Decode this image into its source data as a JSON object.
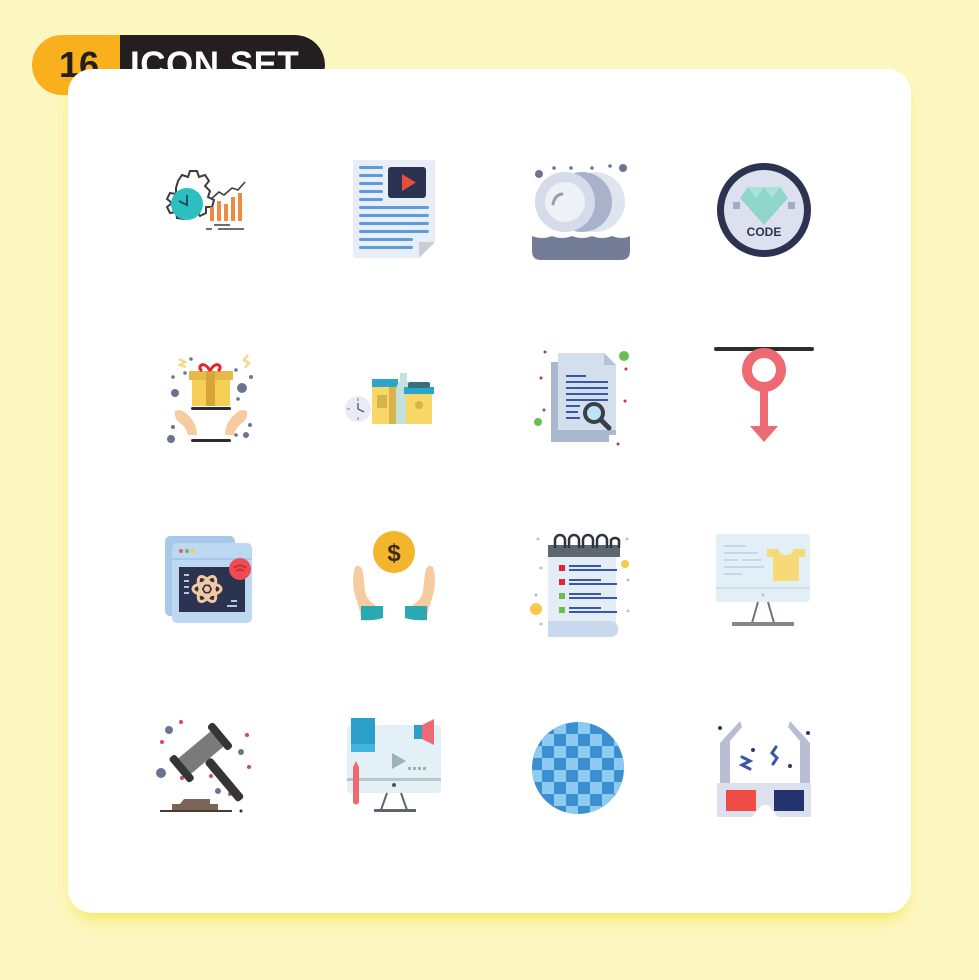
{
  "header": {
    "count": "16",
    "title": "ICON SET"
  },
  "colors": {
    "background": "#fcf7c1",
    "badge_accent": "#f8b01c",
    "badge_dark": "#231f20",
    "card": "#ffffff"
  },
  "icons": [
    {
      "name": "productivity-growth-icon",
      "text": ""
    },
    {
      "name": "video-document-icon",
      "text": ""
    },
    {
      "name": "dishes-washing-icon",
      "text": ""
    },
    {
      "name": "diamond-code-badge-icon",
      "text": "CODE"
    },
    {
      "name": "gift-in-hands-icon",
      "text": ""
    },
    {
      "name": "breakfast-food-icon",
      "text": ""
    },
    {
      "name": "document-search-icon",
      "text": ""
    },
    {
      "name": "male-symbol-arrow-down-icon",
      "text": ""
    },
    {
      "name": "science-browser-icon",
      "text": ""
    },
    {
      "name": "money-in-hands-icon",
      "text": "$"
    },
    {
      "name": "notepad-checklist-icon",
      "text": ""
    },
    {
      "name": "online-shopping-monitor-icon",
      "text": ""
    },
    {
      "name": "gavel-law-icon",
      "text": ""
    },
    {
      "name": "marketing-video-monitor-icon",
      "text": ""
    },
    {
      "name": "disco-globe-icon",
      "text": ""
    },
    {
      "name": "3d-glasses-icon",
      "text": ""
    }
  ]
}
